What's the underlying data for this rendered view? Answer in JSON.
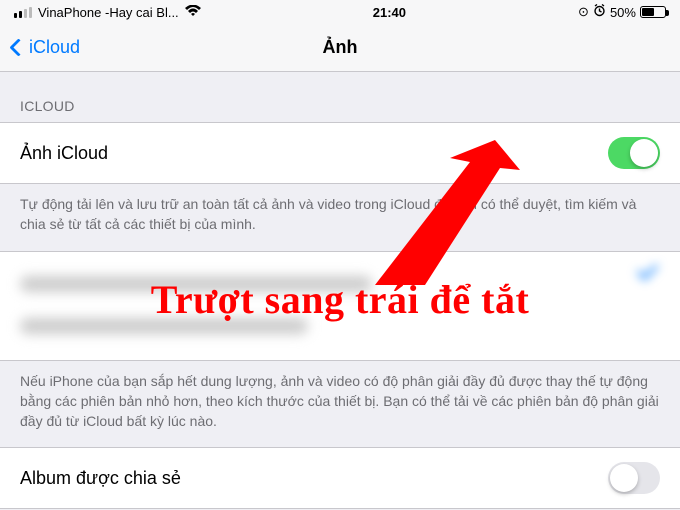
{
  "status": {
    "carrier": "VinaPhone -Hay cai Bl...",
    "time": "21:40",
    "battery_pct": "50%"
  },
  "nav": {
    "back_label": "iCloud",
    "title": "Ảnh"
  },
  "section1_header": "ICLOUD",
  "row_icloud_photos": {
    "label": "Ảnh iCloud"
  },
  "desc1": "Tự động tải lên và lưu trữ an toàn tất cả ảnh và video trong iCloud để bạn có thể duyệt, tìm kiếm và chia sẻ từ tất cả các thiết bị của mình.",
  "desc2": "Nếu iPhone của bạn sắp hết dung lượng, ảnh và video có độ phân giải đầy đủ được thay thế tự động bằng các phiên bản nhỏ hơn, theo kích thước của thiết bị. Bạn có thể tải về các phiên bản độ phân giải đầy đủ từ iCloud bất kỳ lúc nào.",
  "row_shared_album": {
    "label": "Album được chia sẻ"
  },
  "annotation_text": "Trượt sang trái để tắt",
  "colors": {
    "ios_blue": "#007aff",
    "toggle_green": "#4cd964",
    "annotation_red": "#ff0000"
  }
}
